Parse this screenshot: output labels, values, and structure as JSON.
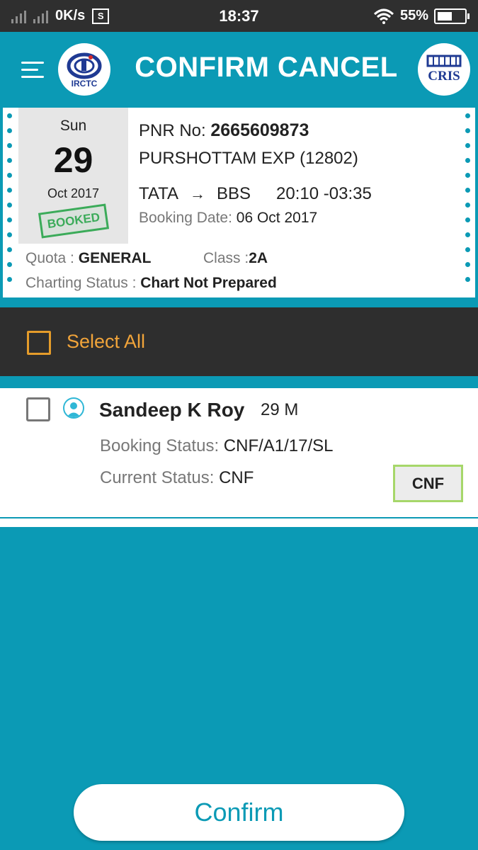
{
  "status_bar": {
    "net_speed": "0K/s",
    "sim_badge": "S",
    "time": "18:37",
    "battery": "55%",
    "battery_level": 0.55
  },
  "app_bar": {
    "title": "CONFIRM CANCEL",
    "left_logo_text": "IRCTC",
    "right_logo_text": "CRIS"
  },
  "ticket": {
    "day": "Sun",
    "date": "29",
    "month_year": "Oct 2017",
    "stamp": "BOOKED",
    "pnr_label": "PNR No:",
    "pnr": "2665609873",
    "train": "PURSHOTTAM EXP (12802)",
    "from": "TATA",
    "to": "BBS",
    "times": "20:10 -03:35",
    "booking_date_label": "Booking Date:",
    "booking_date": "06 Oct 2017",
    "quota_label": "Quota :",
    "quota": "GENERAL",
    "class_label": "Class :",
    "class": "2A",
    "charting_label": "Charting Status :",
    "charting": "Chart Not Prepared"
  },
  "select_all": {
    "label": "Select All",
    "checked": false
  },
  "passengers": [
    {
      "name": "Sandeep K Roy",
      "age_gender": "29 M",
      "booking_status_label": "Booking Status:",
      "booking_status": "CNF/A1/17/SL",
      "current_status_label": "Current Status:",
      "current_status": "CNF",
      "badge": "CNF",
      "checked": false
    }
  ],
  "confirm_button": {
    "label": "Confirm"
  },
  "colors": {
    "primary": "#0b9ab5",
    "accent": "#f1a43a",
    "dark_bar": "#2e2e2e",
    "stamp_green": "#3bab59",
    "badge_border": "#a6d76a"
  },
  "icons": {
    "menu": "hamburger-icon",
    "arrow": "right-arrow-icon",
    "avatar": "person-icon",
    "wifi": "wifi-icon",
    "signal": "signal-icon"
  }
}
